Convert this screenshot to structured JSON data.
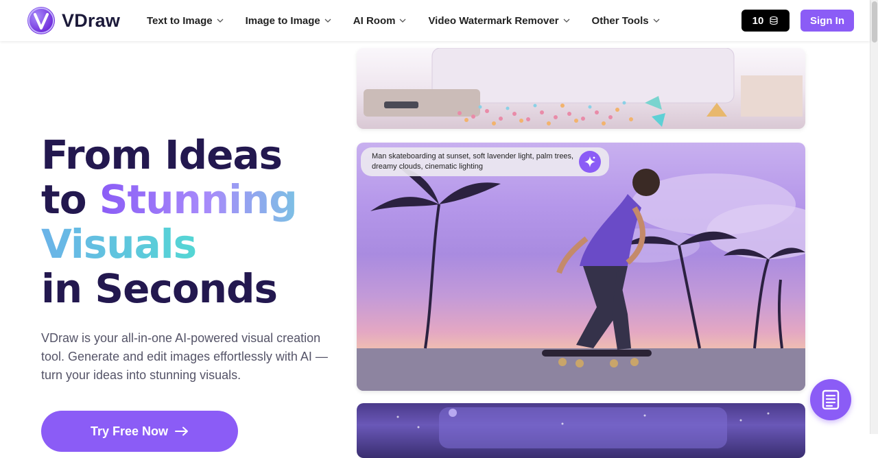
{
  "brand": {
    "name": "VDraw"
  },
  "nav": {
    "items": [
      {
        "label": "Text to Image"
      },
      {
        "label": "Image to Image"
      },
      {
        "label": "AI Room"
      },
      {
        "label": "Video Watermark Remover"
      },
      {
        "label": "Other Tools"
      }
    ]
  },
  "header": {
    "credits": "10",
    "sign_in": "Sign In"
  },
  "hero": {
    "title_line1": "From Ideas",
    "title_to": "to ",
    "title_stunning": "Stunning",
    "title_visuals": "Visuals",
    "title_line4": "in Seconds",
    "description": "VDraw is your all-in-one AI-powered visual creation tool. Generate and edit images effortlessly with AI — turn your ideas into stunning visuals.",
    "cta_label": "Try Free Now"
  },
  "gallery": {
    "prompt": "Man skateboarding at sunset, soft lavender light, palm trees, dreamy clouds, cinematic lighting"
  },
  "colors": {
    "accent": "#8b5cf6",
    "title": "#23184f",
    "credits_bg": "#000000"
  },
  "icons": [
    "chevron-down-icon",
    "coins-icon",
    "sparkle-icon",
    "arrow-right-icon",
    "document-list-icon"
  ]
}
